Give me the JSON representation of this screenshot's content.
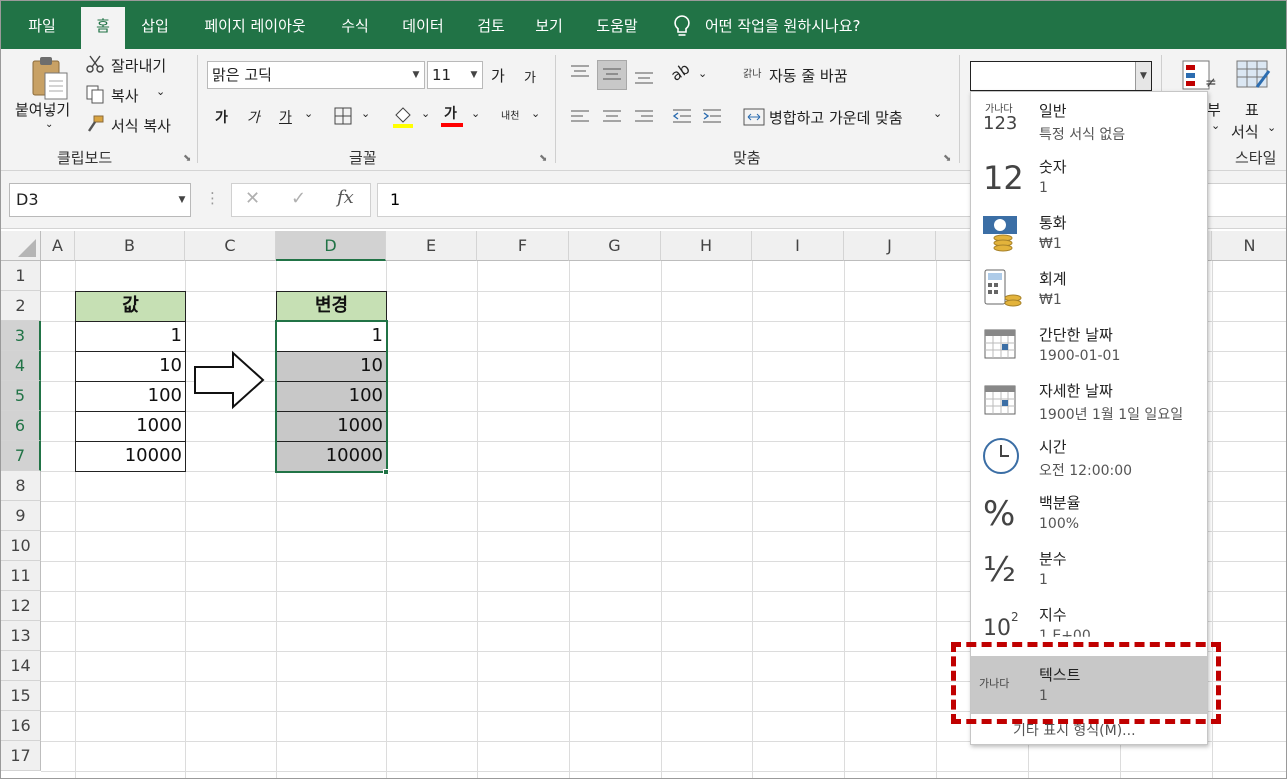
{
  "tabs": [
    "파일",
    "홈",
    "삽입",
    "페이지 레이아웃",
    "수식",
    "데이터",
    "검토",
    "보기",
    "도움말"
  ],
  "tell_me": "어떤 작업을 원하시나요?",
  "clipboard": {
    "paste": "붙여넣기",
    "cut": "잘라내기",
    "copy": "복사",
    "format_painter": "서식 복사",
    "group": "클립보드"
  },
  "font": {
    "name": "맑은 고딕",
    "size": "11",
    "grow": "가",
    "shrink": "가",
    "bold": "가",
    "italic": "가",
    "underline": "가",
    "color_letter": "가",
    "phonetic": "내천",
    "group": "글꼴"
  },
  "alignment": {
    "wrap": "자동 줄 바꿈",
    "merge": "병합하고 가운데 맞춤",
    "group": "맞춤",
    "wrap_icon": "갉나"
  },
  "styles": {
    "conditional": "부",
    "table_label": "표",
    "table_format": "서식",
    "group": "스타일"
  },
  "name_box": "D3",
  "formula_value": "1",
  "fx": "fx",
  "columns": [
    "A",
    "B",
    "C",
    "D",
    "E",
    "F",
    "G",
    "H",
    "I",
    "J",
    "",
    "",
    "",
    "N"
  ],
  "rows": [
    "1",
    "2",
    "3",
    "4",
    "5",
    "6",
    "7",
    "8",
    "9",
    "10",
    "11",
    "12",
    "13",
    "14",
    "15",
    "16",
    "17"
  ],
  "table_left": {
    "header": "값",
    "values": [
      "1",
      "10",
      "100",
      "1000",
      "10000"
    ]
  },
  "table_right": {
    "header": "변경",
    "values": [
      "1",
      "10",
      "100",
      "1000",
      "10000"
    ]
  },
  "number_format": {
    "current": "",
    "items": [
      {
        "name": "일반",
        "example": "특정 서식 없음",
        "icon_top": "가나다",
        "icon_bottom": "123"
      },
      {
        "name": "숫자",
        "example": "1",
        "icon": "12"
      },
      {
        "name": "통화",
        "example": "₩1",
        "icon": "currency-icon"
      },
      {
        "name": "회계",
        "example": " ₩1",
        "icon": "accounting-icon"
      },
      {
        "name": "간단한 날짜",
        "example": "1900-01-01",
        "icon": "calendar-icon"
      },
      {
        "name": "자세한 날짜",
        "example": "1900년 1월 1일 일요일",
        "icon": "calendar-icon"
      },
      {
        "name": "시간",
        "example": "오전 12:00:00",
        "icon": "clock-icon"
      },
      {
        "name": "백분율",
        "example": "100%",
        "icon": "%"
      },
      {
        "name": "분수",
        "example": "1",
        "icon": "½"
      },
      {
        "name": "지수",
        "example": "1.E+00",
        "icon_base": "10",
        "icon_sup": "2"
      },
      {
        "name": "텍스트",
        "example": "1",
        "icon": "가나다"
      }
    ],
    "more": "기타 표시 형식(M)...",
    "highlight_color": "#c00000",
    "selected_bg": "#c8c8c8"
  },
  "colors": {
    "excel_green": "#217346",
    "header_fill": "#c6e0b4",
    "selected_fill": "#c8c8c8"
  }
}
